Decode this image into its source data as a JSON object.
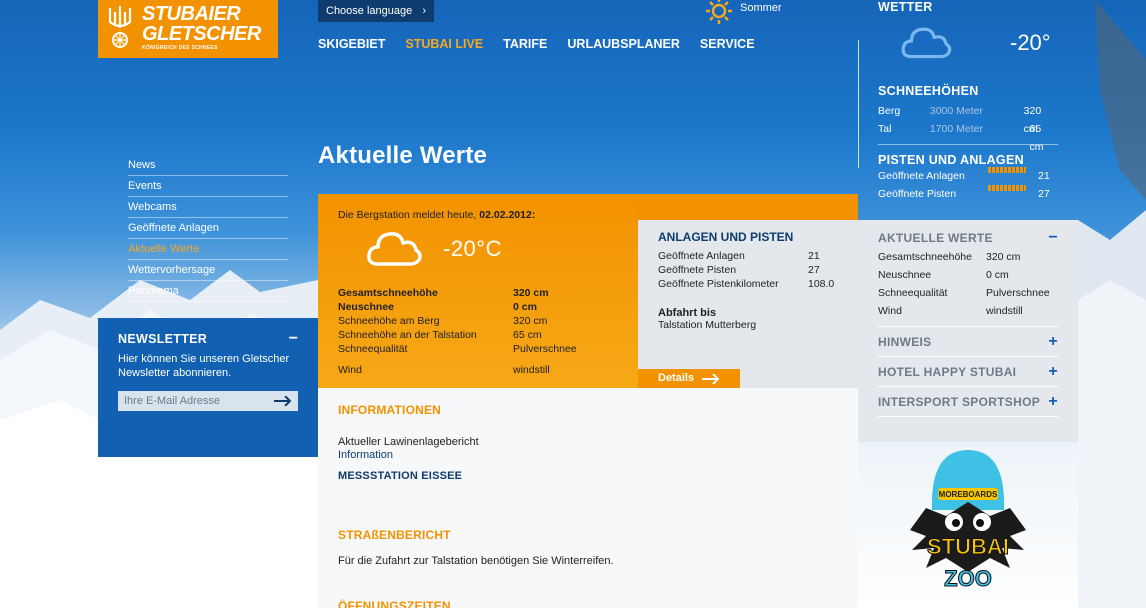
{
  "logo": {
    "line1": "STUBAIER",
    "line2": "GLETSCHER",
    "tagline": "KÖNIGREICH DES SCHNEES"
  },
  "header": {
    "language": "Choose language",
    "season": "Sommer",
    "nav": [
      "SKIGEBIET",
      "STUBAI LIVE",
      "TARIFE",
      "URLAUBSPLANER",
      "SERVICE"
    ],
    "nav_active": "STUBAI LIVE"
  },
  "sidebar": {
    "items": [
      "News",
      "Events",
      "Webcams",
      "Geöffnete Anlagen",
      "Aktuelle Werte",
      "Wettervorhersage",
      "Panorama"
    ],
    "active": "Aktuelle Werte"
  },
  "newsletter": {
    "title": "NEWSLETTER",
    "text": "Hier können Sie unseren Gletscher Newsletter abonnieren.",
    "placeholder": "Ihre E-Mail Adresse"
  },
  "main": {
    "title": "Aktuelle Werte",
    "report": {
      "intro": "Die Bergstation meldet heute,",
      "date": "02.02.2012:",
      "temperature": "-20°C",
      "rows": [
        {
          "label": "Gesamtschneehöhe",
          "value": "320 cm"
        },
        {
          "label": "Neuschnee",
          "value": "0 cm"
        },
        {
          "label": "Schneehöhe am Berg",
          "value": "320 cm"
        },
        {
          "label": "Schneehöhe an der Talstation",
          "value": "65 cm"
        },
        {
          "label": "Schneequalität",
          "value": "Pulverschnee"
        },
        {
          "label": "Wind",
          "value": "windstill"
        }
      ]
    },
    "anlagen": {
      "title": "ANLAGEN UND PISTEN",
      "rows": [
        {
          "label": "Geöffnete Anlagen",
          "value": "21"
        },
        {
          "label": "Geöffnete Pisten",
          "value": "27"
        },
        {
          "label": "Geöffnete Pistenkilometer",
          "value": "108.0"
        }
      ],
      "abfahrt_title": "Abfahrt bis",
      "abfahrt_value": "Talstation Mutterberg",
      "details_label": "Details"
    },
    "informationen": {
      "title": "INFORMATIONEN",
      "line1": "Aktueller Lawinenlagebericht",
      "link": "Information",
      "messstation": "MESSSTATION EISSEE"
    },
    "strassenbericht": {
      "title": "STRAßENBERICHT",
      "text": "Für die Zufahrt zur Talstation benötigen Sie Winterreifen."
    },
    "oeffnungszeiten": {
      "title": "ÖFFNUNGSZEITEN"
    }
  },
  "right": {
    "wetter": {
      "title": "WETTER",
      "temperature": "-20°"
    },
    "schneehoehen": {
      "title": "SCHNEEHÖHEN",
      "rows": [
        {
          "label": "Berg",
          "alt": "3000 Meter",
          "value": "320 cm"
        },
        {
          "label": "Tal",
          "alt": "1700 Meter",
          "value": "65 cm"
        }
      ]
    },
    "pisten": {
      "title": "PISTEN UND ANLAGEN",
      "rows": [
        {
          "label": "Geöffnete Anlagen",
          "value": "21"
        },
        {
          "label": "Geöffnete Pisten",
          "value": "27"
        }
      ]
    },
    "aktuelle": {
      "title": "AKTUELLE WERTE",
      "rows": [
        {
          "label": "Gesamtschneehöhe",
          "value": "320 cm"
        },
        {
          "label": "Neuschnee",
          "value": "0 cm"
        },
        {
          "label": "Schneequalität",
          "value": "Pulverschnee"
        },
        {
          "label": "Wind",
          "value": "windstill"
        }
      ]
    },
    "sections": [
      "HINWEIS",
      "HOTEL HAPPY STUBAI",
      "INTERSPORT SPORTSHOP"
    ]
  },
  "mascot": {
    "badge": "MOREBOARDS",
    "word1": "STUBAI",
    "word2": "ZOO"
  },
  "colors": {
    "orange": "#f39200",
    "navy": "#0e3c6e",
    "blue": "#1260b2",
    "panel": "#e4e8ec"
  }
}
